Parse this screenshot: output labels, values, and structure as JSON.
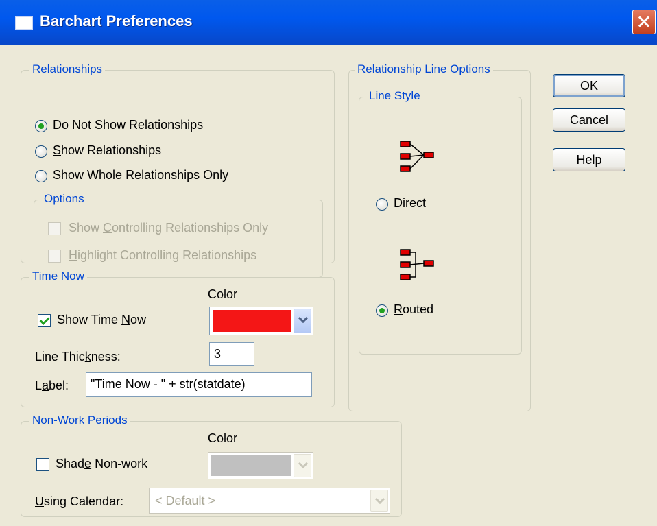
{
  "window": {
    "title": "Barchart Preferences",
    "close_icon": "close-icon"
  },
  "relationships": {
    "legend": "Relationships",
    "radios": [
      {
        "label_pre": "",
        "label_ul": "D",
        "label_post": "o Not Show Relationships",
        "selected": true
      },
      {
        "label_pre": "",
        "label_ul": "S",
        "label_post": "how Relationships",
        "selected": false
      },
      {
        "label_pre": "Show ",
        "label_ul": "W",
        "label_post": "hole Relationships Only",
        "selected": false
      }
    ],
    "options": {
      "legend": "Options",
      "checks": [
        {
          "label_pre": "Show ",
          "label_ul": "C",
          "label_post": "ontrolling Relationships Only",
          "checked": false,
          "enabled": false
        },
        {
          "label_pre": "",
          "label_ul": "H",
          "label_post": "ighlight Controlling Relationships",
          "checked": false,
          "enabled": false
        }
      ]
    }
  },
  "time_now": {
    "legend": "Time Now",
    "color_label": "Color",
    "show_pre": "Show Time ",
    "show_ul": "N",
    "show_post": "ow",
    "show_checked": true,
    "color_value": "#f41616",
    "thickness_pre": "Line Thic",
    "thickness_ul": "k",
    "thickness_post": "ness:",
    "thickness_value": "3",
    "label_pre": "L",
    "label_ul": "a",
    "label_post": "bel:",
    "label_value": "\"Time Now - \" + str(statdate)"
  },
  "non_work": {
    "legend": "Non-Work Periods",
    "color_label": "Color",
    "shade_pre": "Shad",
    "shade_ul": "e",
    "shade_post": " Non-work",
    "shade_checked": false,
    "color_value": "#c0c0c0",
    "calendar_pre": "",
    "calendar_ul": "U",
    "calendar_post": "sing Calendar:",
    "calendar_value": "< Default >"
  },
  "line_options": {
    "legend": "Relationship Line Options",
    "style": {
      "legend": "Line Style",
      "direct_pre": "D",
      "direct_ul": "i",
      "direct_post": "rect",
      "direct_selected": false,
      "routed_pre": "",
      "routed_ul": "R",
      "routed_post": "outed",
      "routed_selected": true
    }
  },
  "buttons": {
    "ok": "OK",
    "cancel": "Cancel",
    "help_ul": "H",
    "help_post": "elp"
  },
  "colors": {
    "accent": "#0046d5",
    "title_bar": "#0058ee",
    "dialog_bg": "#ece9d8"
  }
}
